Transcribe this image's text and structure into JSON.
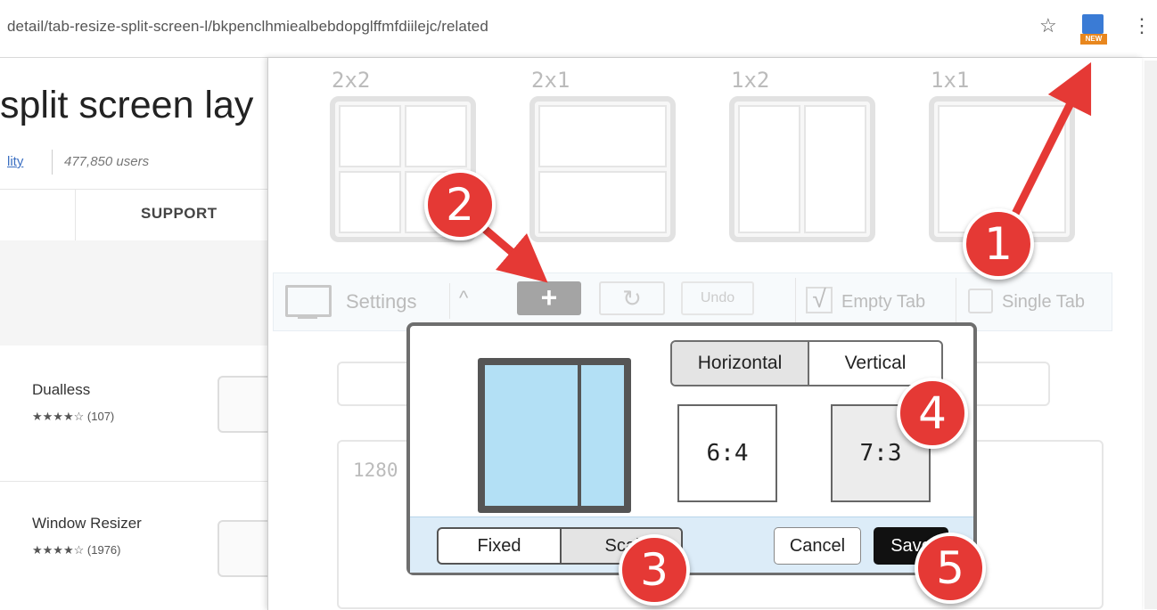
{
  "browser": {
    "url": "detail/tab-resize-split-screen-l/bkpenclhmiealbebdopglffmfdiilejc/related",
    "ext_badge": "NEW"
  },
  "store_page": {
    "title": "split screen lay",
    "category_link": "lity",
    "users": "477,850 users",
    "support_tab": "SUPPORT",
    "related": [
      {
        "name": "Dualless",
        "stars": "★★★★☆",
        "count": "(107)"
      },
      {
        "name": "Window Resizer",
        "stars": "★★★★☆",
        "count": "(1976)"
      }
    ]
  },
  "popup": {
    "layouts": [
      "2x2",
      "2x1",
      "1x2",
      "1x1"
    ],
    "toolbar": {
      "settings": "Settings",
      "chevron": "^",
      "add": "+",
      "refresh": "↻",
      "undo": "Undo",
      "empty_tab_check": "√",
      "empty_tab": "Empty Tab",
      "single_tab": "Single Tab"
    },
    "resolution_text": "1280"
  },
  "dialog": {
    "orientation": {
      "options": [
        "Horizontal",
        "Vertical"
      ],
      "selected": "Horizontal"
    },
    "ratios": [
      {
        "label": "6:4",
        "selected": false
      },
      {
        "label": "7:3",
        "selected": true
      }
    ],
    "mode": {
      "options": [
        "Fixed",
        "Scal"
      ],
      "selected": "Scal"
    },
    "cancel": "Cancel",
    "save": "Save"
  },
  "annotations": [
    "1",
    "2",
    "3",
    "4",
    "5"
  ],
  "colors": {
    "accent_red": "#e53935",
    "pane_blue": "#b3e0f5",
    "footer_blue": "#dcecf8"
  }
}
